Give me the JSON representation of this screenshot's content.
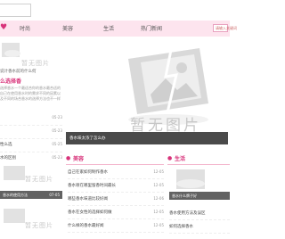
{
  "colors": {
    "accent": "#d8337a",
    "nav_bg": "#fde4ee",
    "placeholder": "#d6d6d6",
    "caption_bg": "#4a4a4a"
  },
  "header": {
    "nav": {
      "home_icon": "heart-icon",
      "items": [
        "时尚",
        "美容",
        "生活",
        "热门新闻"
      ],
      "search_text": "请输入关键词"
    }
  },
  "placeholder_text": "暂无图片",
  "left": {
    "top_line": "说计香水前的什么何",
    "heading": "么选择香",
    "description": "选择香水一个最适合你的香水最合适的自己在使用香水时的需求不同的因素以及不同的场合香水的选择方法也不一样",
    "list": [
      {
        "title": "",
        "date": "05-23"
      },
      {
        "title": "",
        "date": "05-23"
      },
      {
        "title": "性么选",
        "date": "05-25"
      },
      {
        "title": "水的区别",
        "date": "05-23"
      }
    ]
  },
  "banner": {
    "caption": "香水味太浓了怎么办"
  },
  "sections": {
    "beauty": {
      "title": "美容",
      "items": [
        {
          "title": "自己在家如何制作香水",
          "date": "12-05"
        },
        {
          "title": "香水喷在哪里留香时间最长",
          "date": "12-05"
        },
        {
          "title": "哪些香水味道比较好闻",
          "date": "12-06"
        },
        {
          "title": "香水在女性的选择如何做",
          "date": "12-05"
        },
        {
          "title": "什么样的香水最好闻",
          "date": "12-05"
        }
      ]
    },
    "life": {
      "title": "生活",
      "items": [
        {
          "title": "香水如何选择",
          "date": ""
        },
        {
          "title": "香水的正确喷法",
          "date": ""
        }
      ]
    }
  },
  "thumbs": {
    "left_bottom": {
      "caption": "香水的使用方法",
      "date": "07-05"
    },
    "life_thumb": {
      "caption": "香水什么牌子好"
    },
    "life_lines": [
      "香水使用方法及误区",
      "如何选择香水"
    ]
  }
}
